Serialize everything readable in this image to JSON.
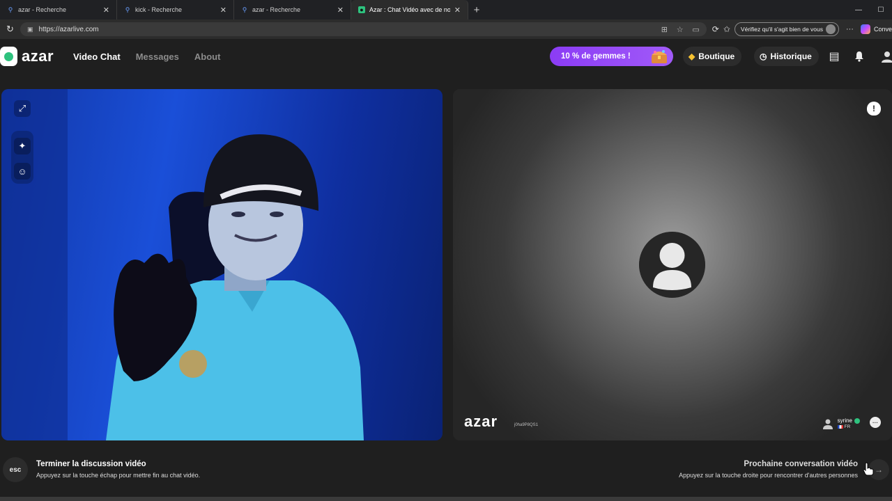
{
  "browser": {
    "tabs": [
      {
        "label": "azar - Recherche",
        "icon": "search-icon"
      },
      {
        "label": "kick - Recherche",
        "icon": "search-icon"
      },
      {
        "label": "azar - Recherche",
        "icon": "search-icon"
      },
      {
        "label": "Azar : Chat Vidéo avec de nou",
        "icon": "azar-favicon",
        "active": true
      }
    ],
    "url": "https://azarlive.com",
    "verify_label": "Vérifiez qu'il s'agit bien de vous",
    "copilot_label": "Conve"
  },
  "app": {
    "logo": "azar",
    "nav": {
      "video_chat": "Video Chat",
      "messages": "Messages",
      "about": "About"
    },
    "promo": "10 % de gemmes !",
    "shop": "Boutique",
    "history": "Historique",
    "accent": "#2ec27e",
    "promo_color": "#8b3cf5"
  },
  "remote": {
    "watermark": "azar",
    "session_id": "j0ha9P8QS1",
    "partner_name": "syrine",
    "partner_country": "FR"
  },
  "footer": {
    "esc_key": "esc",
    "end_title": "Terminer la discussion vidéo",
    "end_sub": "Appuyez sur la touche échap pour mettre fin au chat vidéo.",
    "next_title": "Prochaine conversation vidéo",
    "next_sub": "Appuyez sur la touche droite pour rencontrer d'autres personnes",
    "next_arrow": "→"
  }
}
